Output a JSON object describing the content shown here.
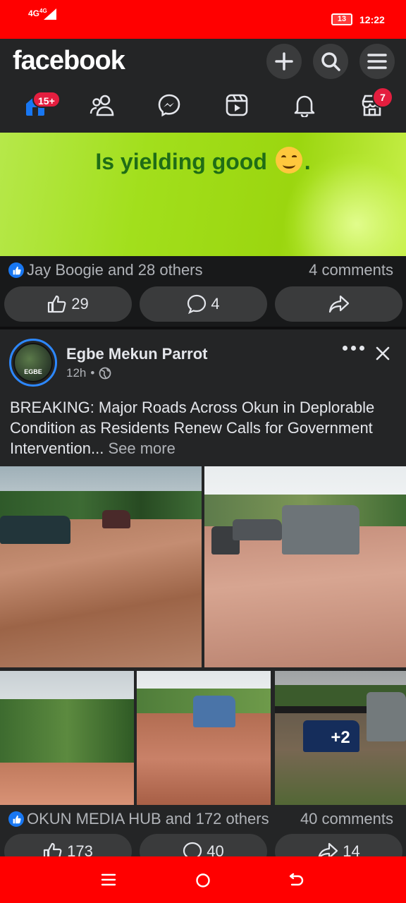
{
  "status_bar": {
    "network": "4G",
    "network_sup": "4G",
    "battery": "13",
    "time": "12:22"
  },
  "header": {
    "logo": "facebook",
    "actions": [
      "plus-icon",
      "search-icon",
      "menu-icon"
    ],
    "nav": [
      {
        "name": "home",
        "badge": "15+"
      },
      {
        "name": "friends",
        "badge": ""
      },
      {
        "name": "messenger",
        "badge": ""
      },
      {
        "name": "video",
        "badge": ""
      },
      {
        "name": "notifications",
        "badge": ""
      },
      {
        "name": "marketplace",
        "badge": "7"
      }
    ]
  },
  "post1": {
    "banner_text": "Is yielding good",
    "banner_suffix": ".",
    "reactions": "Jay Boogie and 28 others",
    "comments": "4 comments",
    "like_count": "29",
    "comment_count": "4",
    "share_count": ""
  },
  "post2": {
    "page_name": "Egbe Mekun Parrot",
    "avatar_text": "EGBE",
    "time": "12h",
    "separator": "•",
    "text": "BREAKING: Major Roads Across Okun in Deplorable Condition as Residents Renew Calls for Government Intervention...",
    "see_more": "See more",
    "more_photos": "+2",
    "reactions": "OKUN MEDIA HUB and 172 others",
    "comments": "40 comments",
    "like_count": "173",
    "comment_count": "40",
    "share_count": "14"
  },
  "colors": {
    "status_bar": "#ff0000",
    "header_bg": "#242526",
    "accent": "#1877f2",
    "badge": "#e41e3f",
    "banner_text": "#1f6d16"
  }
}
